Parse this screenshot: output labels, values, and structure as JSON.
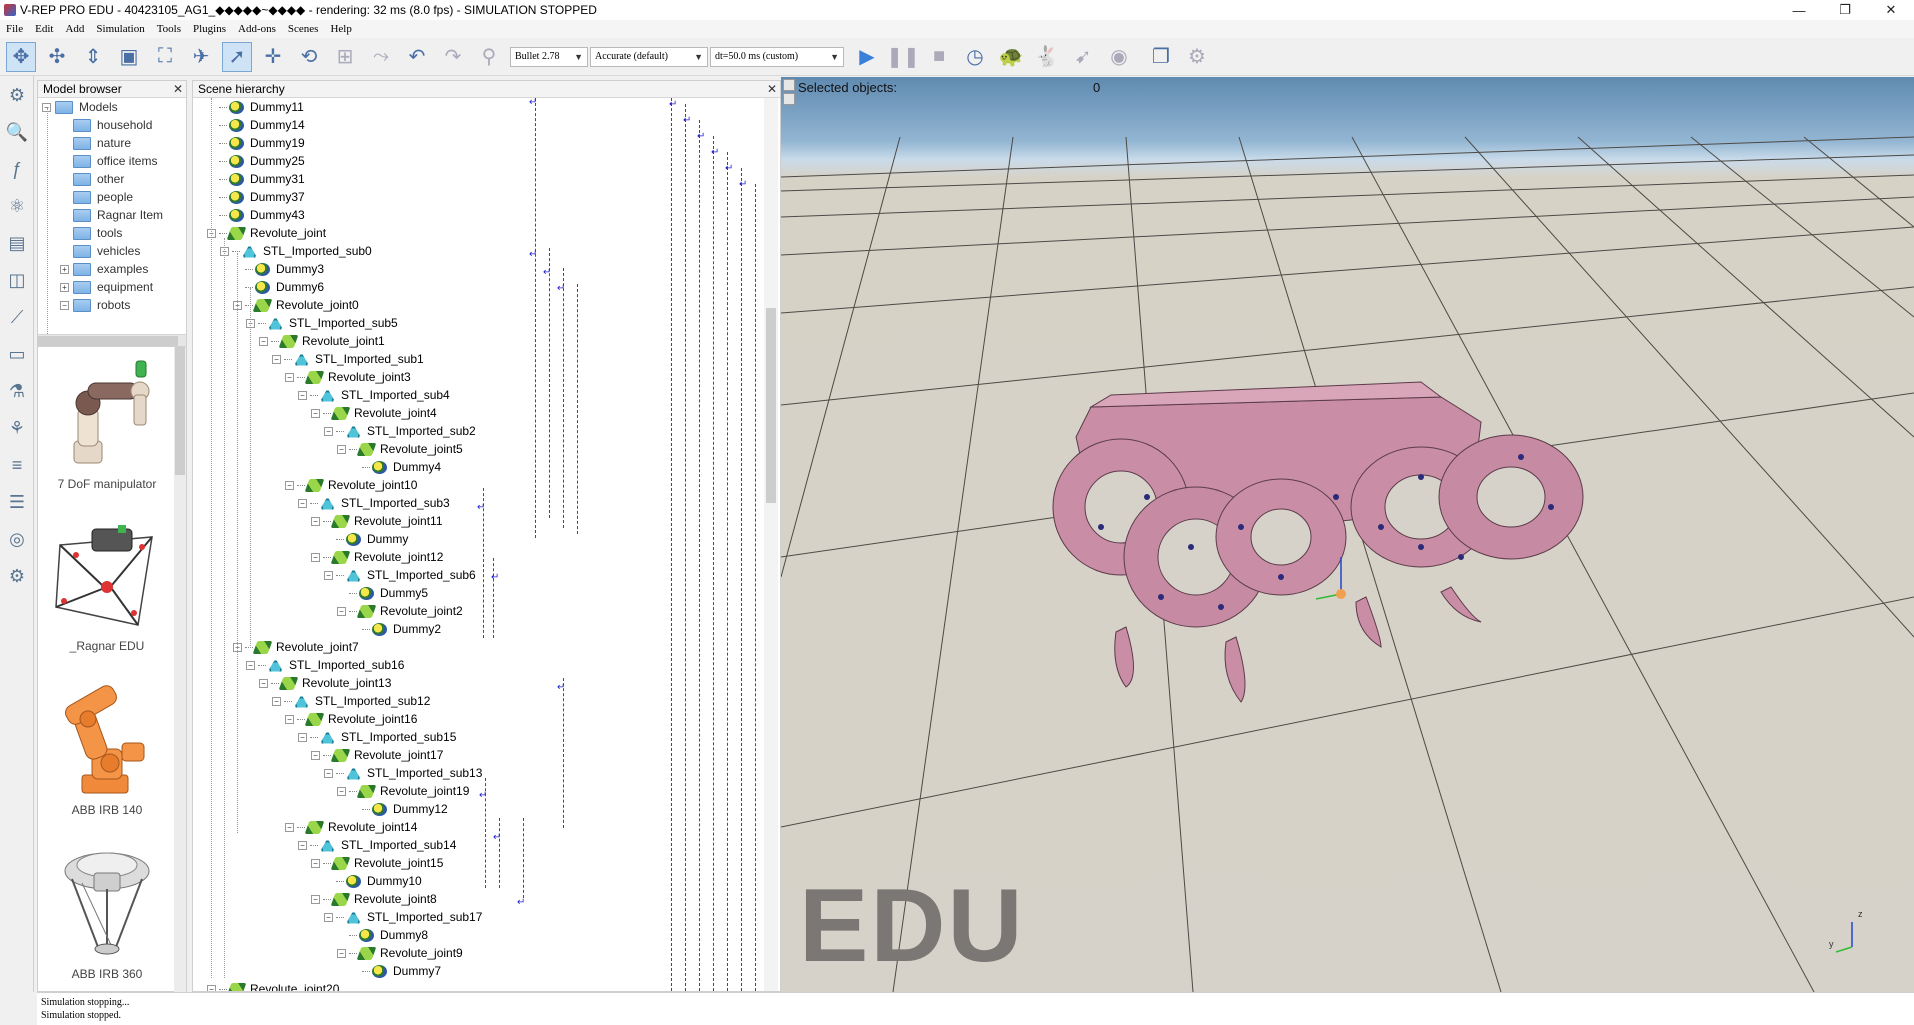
{
  "window": {
    "title": "V-REP PRO EDU - 40423105_AG1_◆◆◆◆◆~◆◆◆◆ - rendering: 32 ms (8.0 fps) - SIMULATION STOPPED",
    "minimize": "—",
    "maximize": "❐",
    "close": "✕"
  },
  "menu": [
    "File",
    "Edit",
    "Add",
    "Simulation",
    "Tools",
    "Plugins",
    "Add-ons",
    "Scenes",
    "Help"
  ],
  "toolbar": {
    "engine": "Bullet 2.78",
    "accuracy": "Accurate (default)",
    "timestep": "dt=50.0 ms (custom)"
  },
  "model_browser": {
    "title": "Model browser",
    "tree": [
      {
        "label": "Models",
        "exp": "−",
        "level": 0
      },
      {
        "label": "household",
        "exp": "",
        "level": 1
      },
      {
        "label": "nature",
        "exp": "",
        "level": 1
      },
      {
        "label": "office items",
        "exp": "",
        "level": 1
      },
      {
        "label": "other",
        "exp": "",
        "level": 1
      },
      {
        "label": "people",
        "exp": "",
        "level": 1
      },
      {
        "label": "Ragnar Item",
        "exp": "",
        "level": 1
      },
      {
        "label": "tools",
        "exp": "",
        "level": 1
      },
      {
        "label": "vehicles",
        "exp": "",
        "level": 1
      },
      {
        "label": "examples",
        "exp": "+",
        "level": 1
      },
      {
        "label": "equipment",
        "exp": "+",
        "level": 1
      },
      {
        "label": "robots",
        "exp": "−",
        "level": 1
      }
    ],
    "thumbnails": [
      "7 DoF manipulator",
      "_Ragnar EDU",
      "ABB IRB 140",
      "ABB IRB 360"
    ]
  },
  "scene_hierarchy": {
    "title": "Scene hierarchy",
    "rows": [
      {
        "label": "Dummy11",
        "type": "dummy",
        "level": 1,
        "exp": ""
      },
      {
        "label": "Dummy14",
        "type": "dummy",
        "level": 1,
        "exp": ""
      },
      {
        "label": "Dummy19",
        "type": "dummy",
        "level": 1,
        "exp": ""
      },
      {
        "label": "Dummy25",
        "type": "dummy",
        "level": 1,
        "exp": ""
      },
      {
        "label": "Dummy31",
        "type": "dummy",
        "level": 1,
        "exp": ""
      },
      {
        "label": "Dummy37",
        "type": "dummy",
        "level": 1,
        "exp": ""
      },
      {
        "label": "Dummy43",
        "type": "dummy",
        "level": 1,
        "exp": ""
      },
      {
        "label": "Revolute_joint",
        "type": "joint",
        "level": 1,
        "exp": "−"
      },
      {
        "label": "STL_Imported_sub0",
        "type": "shape",
        "level": 2,
        "exp": "−"
      },
      {
        "label": "Dummy3",
        "type": "dummy",
        "level": 3,
        "exp": ""
      },
      {
        "label": "Dummy6",
        "type": "dummy",
        "level": 3,
        "exp": ""
      },
      {
        "label": "Revolute_joint0",
        "type": "joint",
        "level": 3,
        "exp": "−"
      },
      {
        "label": "STL_Imported_sub5",
        "type": "shape",
        "level": 4,
        "exp": "−"
      },
      {
        "label": "Revolute_joint1",
        "type": "joint",
        "level": 5,
        "exp": "−"
      },
      {
        "label": "STL_Imported_sub1",
        "type": "shape",
        "level": 6,
        "exp": "−"
      },
      {
        "label": "Revolute_joint3",
        "type": "joint",
        "level": 7,
        "exp": "−"
      },
      {
        "label": "STL_Imported_sub4",
        "type": "shape",
        "level": 8,
        "exp": "−"
      },
      {
        "label": "Revolute_joint4",
        "type": "joint",
        "level": 9,
        "exp": "−"
      },
      {
        "label": "STL_Imported_sub2",
        "type": "shape",
        "level": 10,
        "exp": "−"
      },
      {
        "label": "Revolute_joint5",
        "type": "joint",
        "level": 11,
        "exp": "−"
      },
      {
        "label": "Dummy4",
        "type": "dummy",
        "level": 12,
        "exp": ""
      },
      {
        "label": "Revolute_joint10",
        "type": "joint",
        "level": 7,
        "exp": "−"
      },
      {
        "label": "STL_Imported_sub3",
        "type": "shape",
        "level": 8,
        "exp": "−"
      },
      {
        "label": "Revolute_joint11",
        "type": "joint",
        "level": 9,
        "exp": "−"
      },
      {
        "label": "Dummy",
        "type": "dummy",
        "level": 10,
        "exp": ""
      },
      {
        "label": "Revolute_joint12",
        "type": "joint",
        "level": 9,
        "exp": "−"
      },
      {
        "label": "STL_Imported_sub6",
        "type": "shape",
        "level": 10,
        "exp": "−"
      },
      {
        "label": "Dummy5",
        "type": "dummy",
        "level": 11,
        "exp": ""
      },
      {
        "label": "Revolute_joint2",
        "type": "joint",
        "level": 11,
        "exp": "−"
      },
      {
        "label": "Dummy2",
        "type": "dummy",
        "level": 12,
        "exp": ""
      },
      {
        "label": "Revolute_joint7",
        "type": "joint",
        "level": 3,
        "exp": "−"
      },
      {
        "label": "STL_Imported_sub16",
        "type": "shape",
        "level": 4,
        "exp": "−"
      },
      {
        "label": "Revolute_joint13",
        "type": "joint",
        "level": 5,
        "exp": "−"
      },
      {
        "label": "STL_Imported_sub12",
        "type": "shape",
        "level": 6,
        "exp": "−"
      },
      {
        "label": "Revolute_joint16",
        "type": "joint",
        "level": 7,
        "exp": "−"
      },
      {
        "label": "STL_Imported_sub15",
        "type": "shape",
        "level": 8,
        "exp": "−"
      },
      {
        "label": "Revolute_joint17",
        "type": "joint",
        "level": 9,
        "exp": "−"
      },
      {
        "label": "STL_Imported_sub13",
        "type": "shape",
        "level": 10,
        "exp": "−"
      },
      {
        "label": "Revolute_joint19",
        "type": "joint",
        "level": 11,
        "exp": "−"
      },
      {
        "label": "Dummy12",
        "type": "dummy",
        "level": 12,
        "exp": ""
      },
      {
        "label": "Revolute_joint14",
        "type": "joint",
        "level": 7,
        "exp": "−"
      },
      {
        "label": "STL_Imported_sub14",
        "type": "shape",
        "level": 8,
        "exp": "−"
      },
      {
        "label": "Revolute_joint15",
        "type": "joint",
        "level": 9,
        "exp": "−"
      },
      {
        "label": "Dummy10",
        "type": "dummy",
        "level": 10,
        "exp": ""
      },
      {
        "label": "Revolute_joint8",
        "type": "joint",
        "level": 9,
        "exp": "−"
      },
      {
        "label": "STL_Imported_sub17",
        "type": "shape",
        "level": 10,
        "exp": "−"
      },
      {
        "label": "Dummy8",
        "type": "dummy",
        "level": 11,
        "exp": ""
      },
      {
        "label": "Revolute_joint9",
        "type": "joint",
        "level": 11,
        "exp": "−"
      },
      {
        "label": "Dummy7",
        "type": "dummy",
        "level": 12,
        "exp": ""
      },
      {
        "label": "Revolute_joint20",
        "type": "joint",
        "level": 1,
        "exp": "−"
      }
    ]
  },
  "viewport": {
    "selected_label": "Selected objects:",
    "selected_count": "0",
    "watermark": "EDU",
    "axis_z": "z",
    "axis_y": "y"
  },
  "status": {
    "lines": [
      "Simulation stopping...",
      "Simulation stopped."
    ]
  }
}
